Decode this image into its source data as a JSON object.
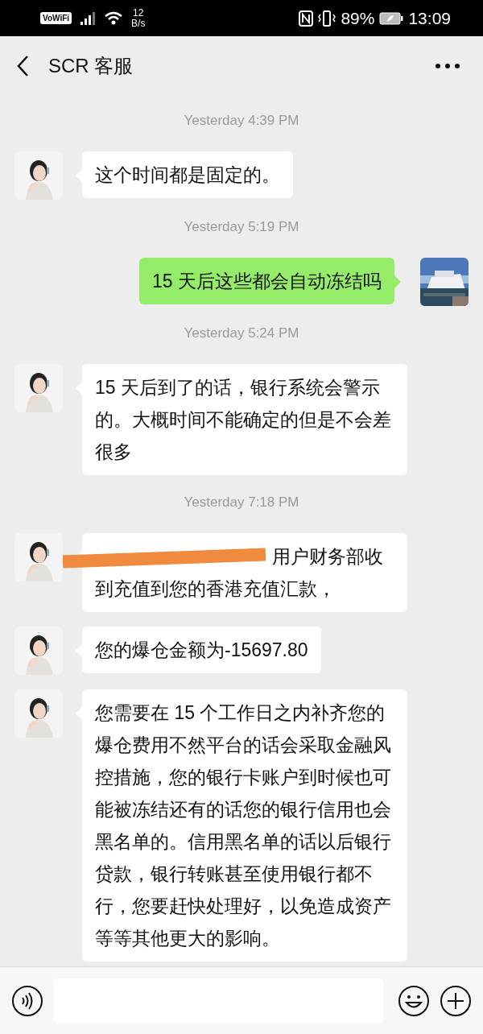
{
  "status_bar": {
    "vowifi": "VoWiFi",
    "speed": "12",
    "speed_unit": "B/s",
    "battery": "89%",
    "time": "13:09"
  },
  "header": {
    "title": "SCR 客服"
  },
  "messages": [
    {
      "kind": "time",
      "text": "Yesterday 4:39 PM"
    },
    {
      "kind": "received",
      "text": "这个时间都是固定的。",
      "redacted": false
    },
    {
      "kind": "time",
      "text": "Yesterday 5:19 PM"
    },
    {
      "kind": "sent",
      "text": "15 天后这些都会自动冻结吗"
    },
    {
      "kind": "time",
      "text": "Yesterday 5:24 PM"
    },
    {
      "kind": "received",
      "text": "15 天后到了的话，银行系统会警示的。大概时间不能确定的但是不会差很多",
      "redacted": false
    },
    {
      "kind": "time",
      "text": "Yesterday 7:18 PM"
    },
    {
      "kind": "received",
      "text": "用户财务部收到充值到您的香港充值汇款，",
      "redacted": true
    },
    {
      "kind": "received",
      "text": "您的爆仓金额为-15697.80",
      "redacted": false
    },
    {
      "kind": "received",
      "text": "您需要在 15 个工作日之内补齐您的爆仓费用不然平台的话会采取金融风控措施，您的银行卡账户到时候也可能被冻结还有的话您的银行信用也会黑名单的。信用黑名单的话以后银行贷款，银行转账甚至使用银行都不行，您要赶快处理好，以免造成资产等等其他更大的影响。",
      "redacted": false
    }
  ]
}
